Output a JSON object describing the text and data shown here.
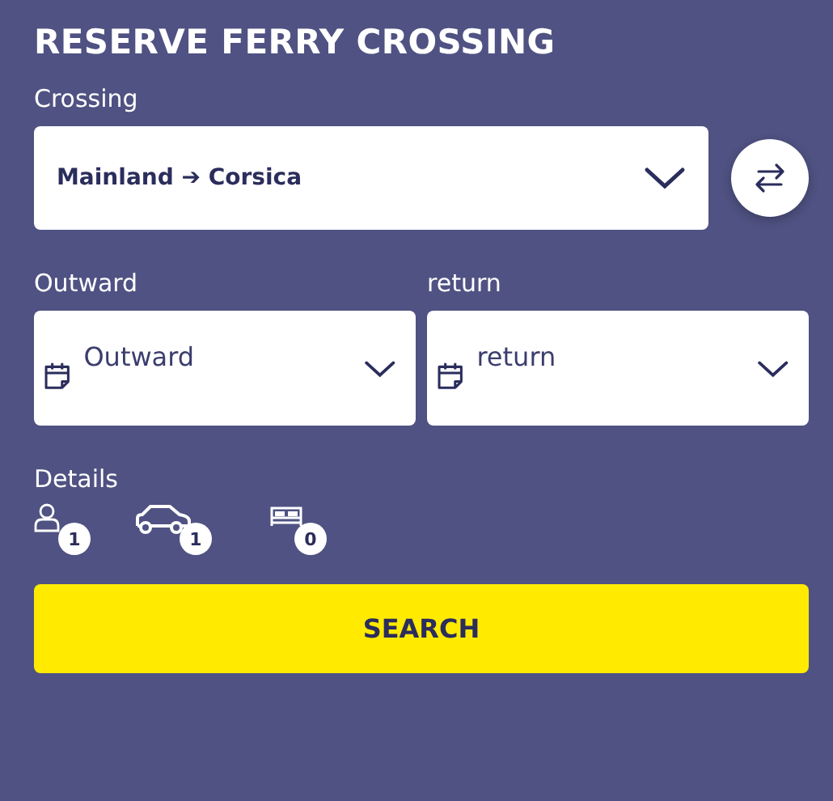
{
  "title": "RESERVE FERRY CROSSING",
  "crossing": {
    "label": "Crossing",
    "value": "Mainland ➔ Corsica"
  },
  "dates": [
    {
      "label": "Outward",
      "placeholder": "Outward"
    },
    {
      "label": "return",
      "placeholder": "return"
    }
  ],
  "details": {
    "label": "Details",
    "items": [
      {
        "kind": "passenger",
        "count": "1"
      },
      {
        "kind": "vehicle",
        "count": "1"
      },
      {
        "kind": "cabin",
        "count": "0"
      }
    ]
  },
  "search_button": "SEARCH"
}
